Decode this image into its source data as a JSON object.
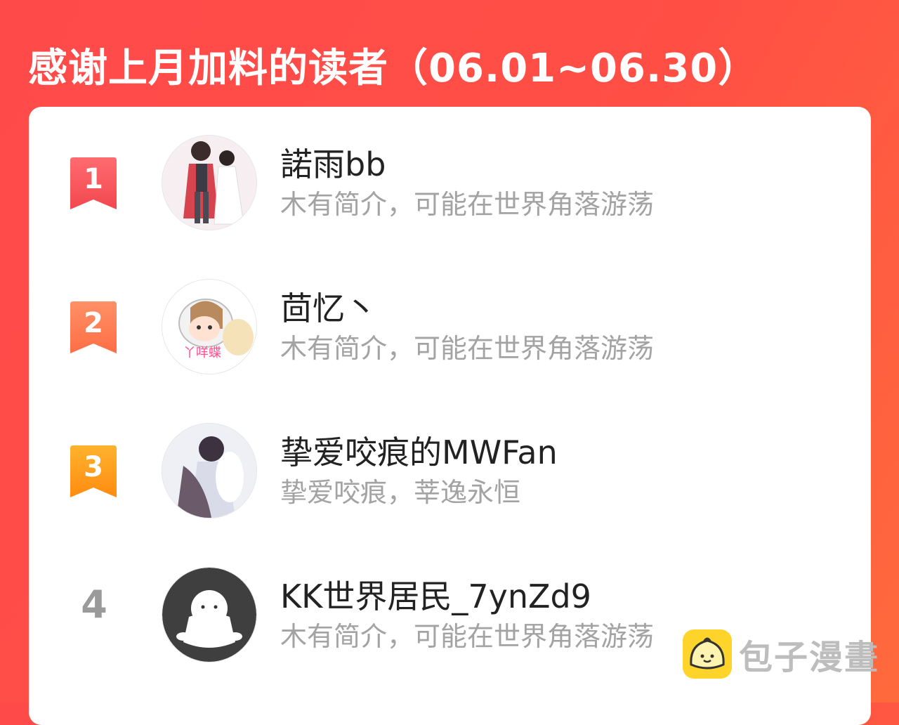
{
  "header": {
    "title": "感谢上月加料的读者（06.01~06.30）"
  },
  "readers": [
    {
      "rank": "1",
      "name": "諾雨bb",
      "bio": "木有简介，可能在世界角落游荡",
      "badge_color": "#f4575f",
      "avatar": "couple-illustration"
    },
    {
      "rank": "2",
      "name": "茴忆丶",
      "bio": "木有简介，可能在世界角落游荡",
      "badge_color": "#ff7a4d",
      "avatar": "chibi-illustration",
      "avatar_text": "丫咩蝶"
    },
    {
      "rank": "3",
      "name": "挚爱咬痕的MWFan",
      "bio": "挚爱咬痕，莘逸永恒",
      "badge_color": "#ff9a1a",
      "avatar": "embrace-illustration"
    },
    {
      "rank": "4",
      "name": "KK世界居民_7ynZd9",
      "bio": "木有简介，可能在世界角落游荡",
      "avatar": "default-ghost-avatar"
    }
  ],
  "watermark": {
    "text": "包子漫畫",
    "logo_color": "#ffd42a"
  }
}
